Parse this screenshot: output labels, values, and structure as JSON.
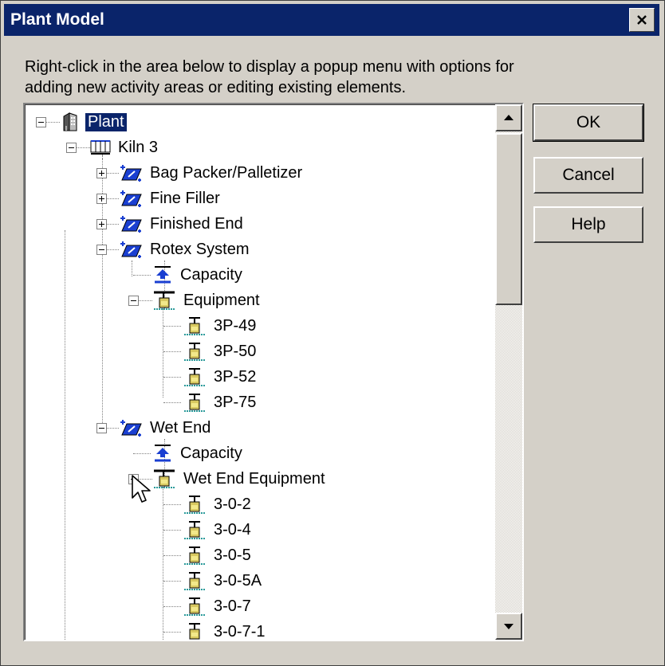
{
  "window": {
    "title": "Plant Model",
    "close_glyph": "✕"
  },
  "instructions": "Right-click in the area below to display a popup menu with options for adding new activity areas or editing existing elements.",
  "buttons": {
    "ok": "OK",
    "cancel": "Cancel",
    "help": "Help"
  },
  "tree": {
    "nodes": [
      {
        "label": "Plant",
        "icon": "building-icon",
        "selected": true,
        "expanded": true
      },
      {
        "label": "Kiln 3",
        "icon": "kiln-icon",
        "expanded": true
      },
      {
        "label": "Bag Packer/Palletizer",
        "icon": "activity-area-icon",
        "expanded": false
      },
      {
        "label": "Fine Filler",
        "icon": "activity-area-icon",
        "expanded": false
      },
      {
        "label": "Finished End",
        "icon": "activity-area-icon",
        "expanded": false
      },
      {
        "label": "Rotex System",
        "icon": "activity-area-icon",
        "expanded": true
      },
      {
        "label": "Capacity",
        "icon": "capacity-icon"
      },
      {
        "label": "Equipment",
        "icon": "equipment-folder-icon",
        "expanded": true
      },
      {
        "label": "3P-49",
        "icon": "equipment-icon"
      },
      {
        "label": "3P-50",
        "icon": "equipment-icon"
      },
      {
        "label": "3P-52",
        "icon": "equipment-icon"
      },
      {
        "label": "3P-75",
        "icon": "equipment-icon"
      },
      {
        "label": "Wet End",
        "icon": "activity-area-icon",
        "expanded": true
      },
      {
        "label": "Capacity",
        "icon": "capacity-icon"
      },
      {
        "label": "Wet End Equipment",
        "icon": "equipment-folder-icon",
        "expanded": true
      },
      {
        "label": "3-0-2",
        "icon": "equipment-icon"
      },
      {
        "label": "3-0-4",
        "icon": "equipment-icon"
      },
      {
        "label": "3-0-5",
        "icon": "equipment-icon"
      },
      {
        "label": "3-0-5A",
        "icon": "equipment-icon"
      },
      {
        "label": "3-0-7",
        "icon": "equipment-icon"
      },
      {
        "label": "3-0-7-1",
        "icon": "equipment-icon"
      }
    ]
  },
  "colors": {
    "titlebar": "#0a246a",
    "selection": "#0a246a",
    "face": "#d4d0c8",
    "activity_icon": "#1a3fd1",
    "equipment_icon": "#d8c860"
  }
}
